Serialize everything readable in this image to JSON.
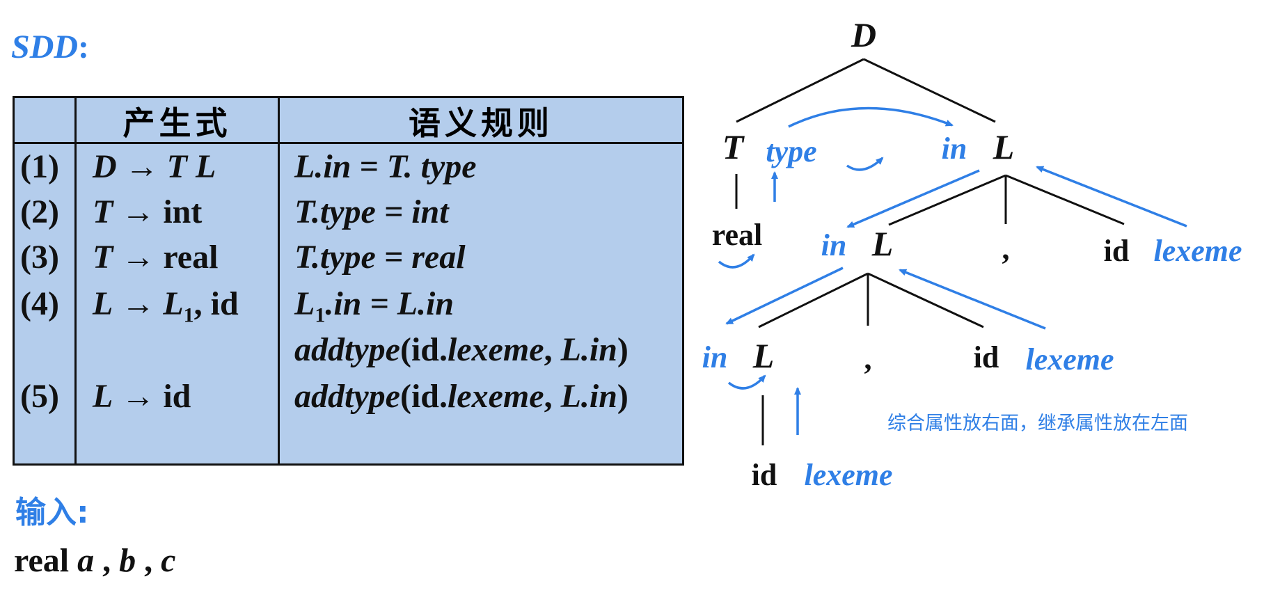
{
  "title": {
    "label": "SDD",
    "colon": ":"
  },
  "table": {
    "headers": {
      "production": "产生式",
      "rule": "语义规则"
    },
    "rows": [
      {
        "num": "(1)",
        "prod": [
          "D",
          " → ",
          "T L"
        ],
        "rule": "L.in = T. type"
      },
      {
        "num": "(2)",
        "prod": [
          "T",
          " → ",
          "int"
        ],
        "rule": "T.type = int"
      },
      {
        "num": "(3)",
        "prod": [
          "T",
          " → ",
          "real"
        ],
        "rule": "T.type = real"
      },
      {
        "num": "(4)",
        "prod": [
          "L",
          " → ",
          "L",
          "1",
          ", id"
        ],
        "rule_a": "L",
        "rule_sub": "1",
        "rule_b": ".in = L.in"
      },
      {
        "num": "",
        "rule_fn": "addtype",
        "rule_args_a": "(id.",
        "rule_args_b": "lexeme",
        "rule_args_c": ", ",
        "rule_args_d": "L.in",
        "rule_args_e": ")"
      },
      {
        "num": "(5)",
        "prod": [
          "L",
          " → ",
          "id"
        ],
        "rule_fn": "addtype",
        "rule_args_a": "(id.",
        "rule_args_b": "lexeme",
        "rule_args_c": ", ",
        "rule_args_d": "L.in",
        "rule_args_e": ")"
      }
    ]
  },
  "input": {
    "label": "输入:",
    "text_a": "real ",
    "text_b": "a",
    "text_c": " , ",
    "text_d": "b",
    "text_e": " , ",
    "text_f": "c"
  },
  "tree": {
    "root": "D",
    "T": "T",
    "type": "type",
    "in": "in",
    "L": "L",
    "real": "real",
    "comma": ",",
    "id": "id",
    "lexeme": "lexeme",
    "note": "综合属性放右面，继承属性放在左面"
  },
  "colors": {
    "accent": "#2f7fe6",
    "table_bg": "#b4cdec",
    "ink": "#111111"
  }
}
